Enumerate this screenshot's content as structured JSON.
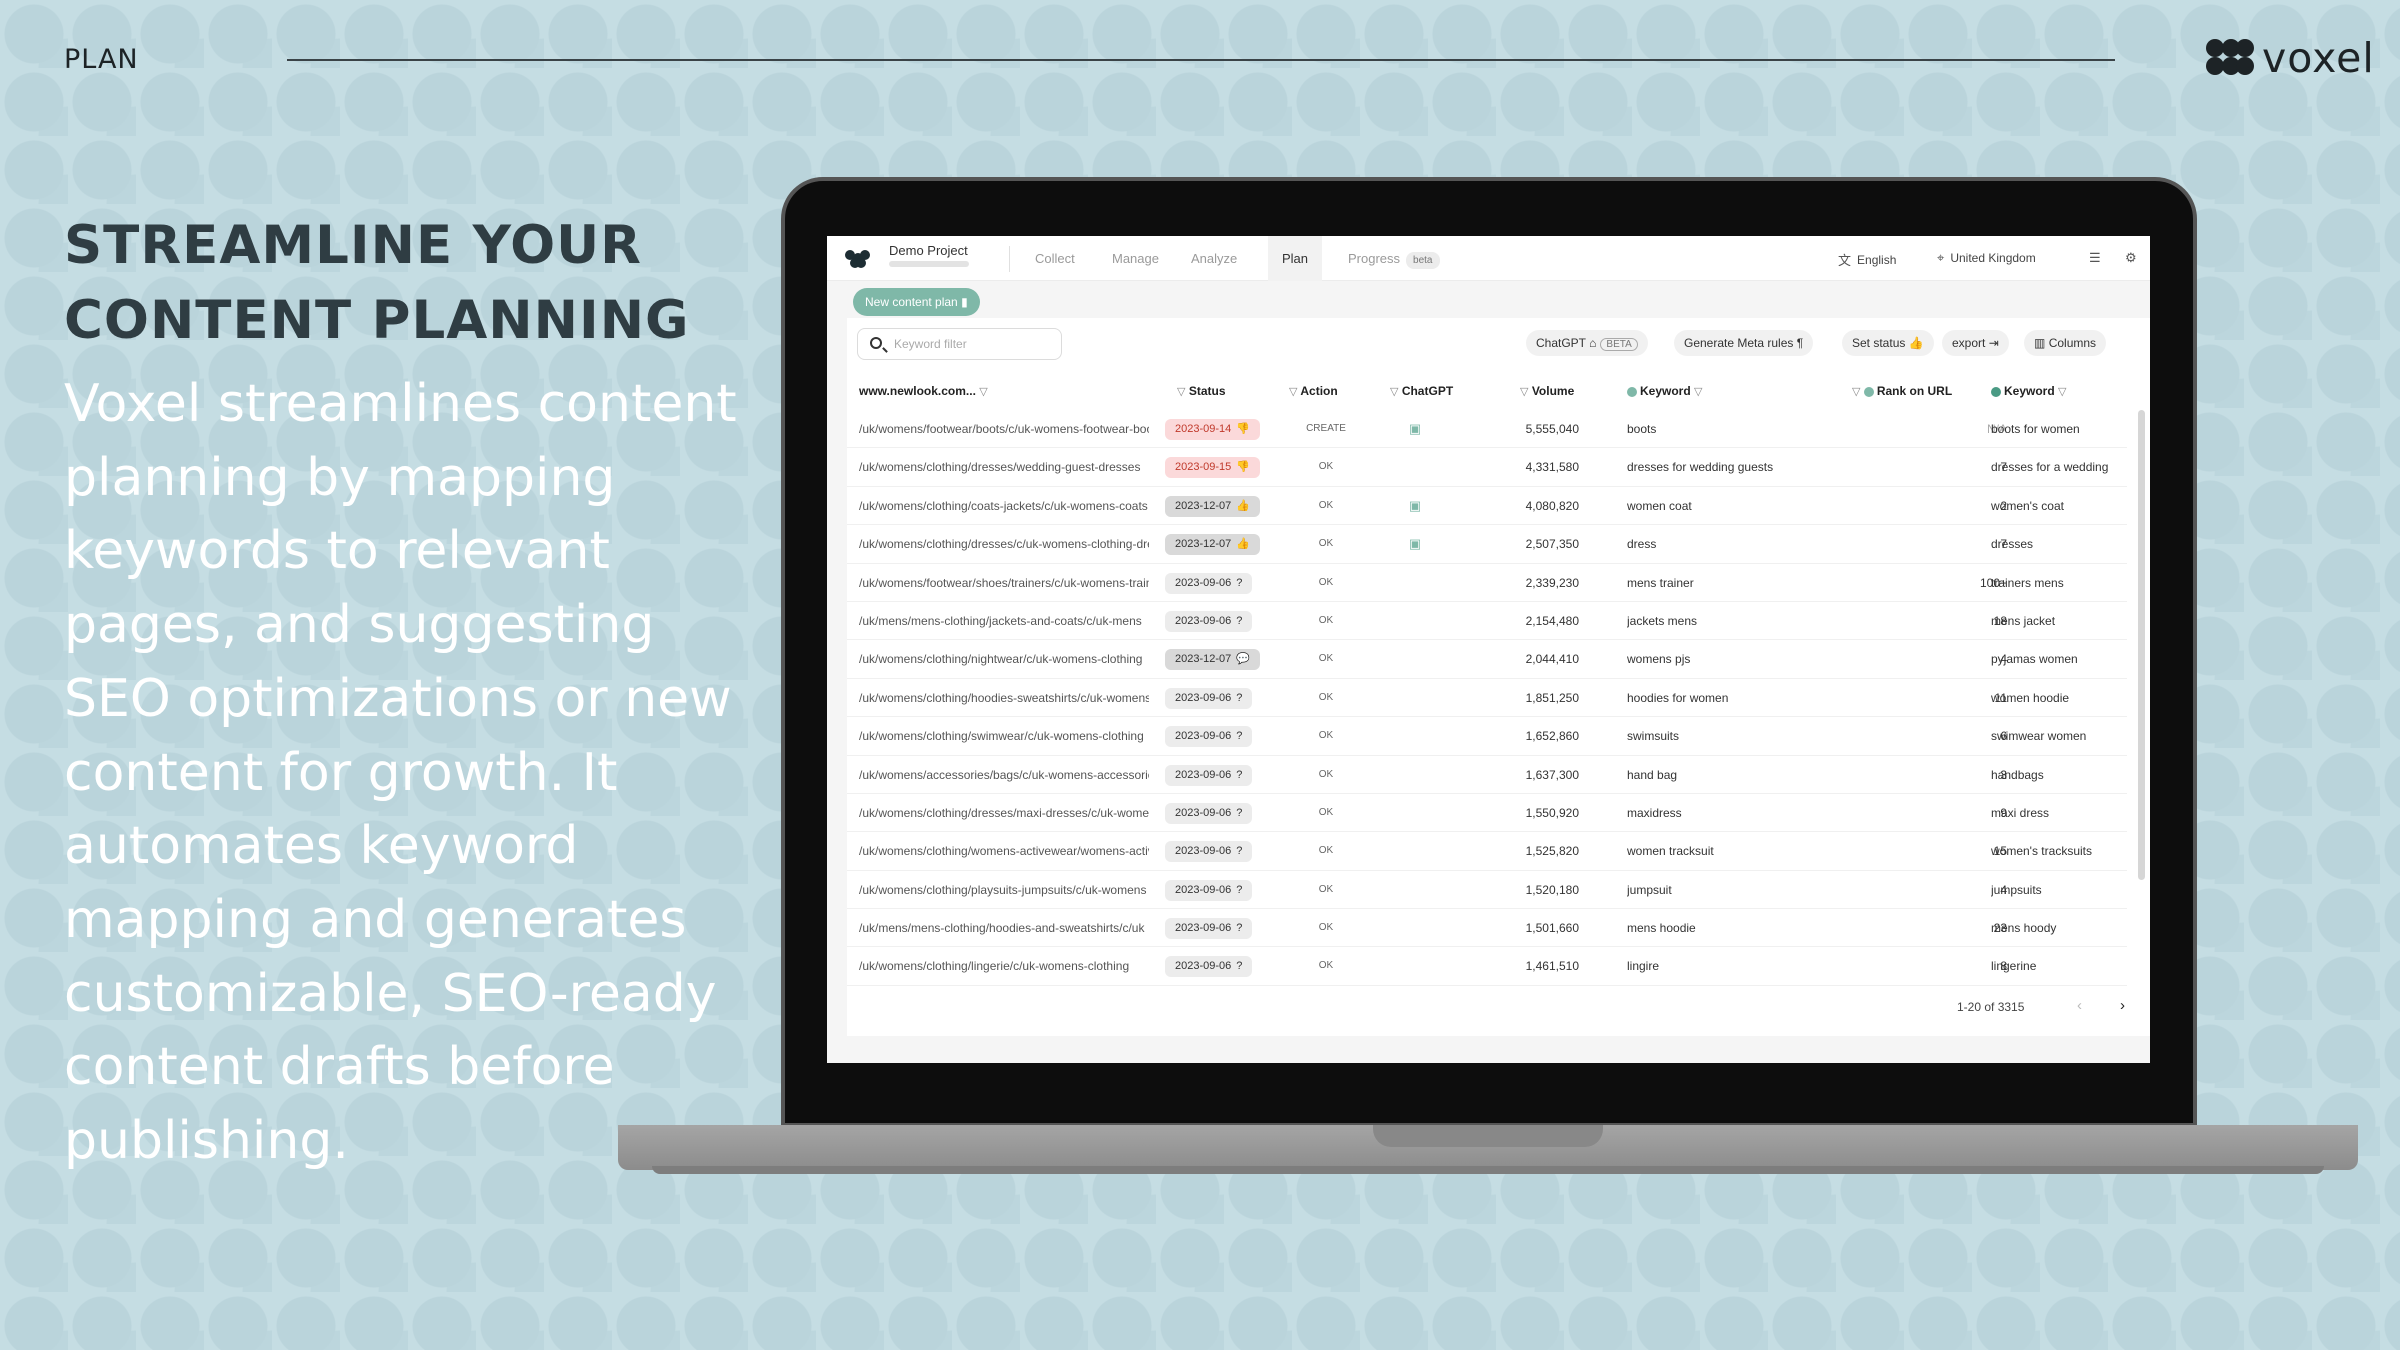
{
  "header": {
    "section_label": "PLAN",
    "brand_name": "voxel"
  },
  "hero": {
    "headline": "STREAMLINE YOUR CONTENT PLANNING",
    "body": "Voxel streamlines content planning by mapping keywords to relevant pages, and suggesting SEO optimizations or new content for growth. It automates keyword mapping and generates customizable, SEO-ready content drafts before publishing."
  },
  "app": {
    "project_name": "Demo Project",
    "nav_tabs": [
      "Collect",
      "Manage",
      "Analyze",
      "Plan",
      "Progress"
    ],
    "active_tab": "Plan",
    "progress_badge": "beta",
    "language": "English",
    "country": "United Kingdom",
    "new_plan_label": "New content plan",
    "keyword_filter_placeholder": "Keyword filter",
    "toolbar": {
      "chatgpt": "ChatGPT",
      "chatgpt_badge": "BETA",
      "meta_rules": "Generate Meta rules",
      "set_status": "Set status",
      "export": "export",
      "columns": "Columns"
    },
    "columns": {
      "url": "www.newlook.com...",
      "status": "Status",
      "action": "Action",
      "chatgpt": "ChatGPT",
      "volume": "Volume",
      "keyword": "Keyword",
      "rank": "Rank on URL",
      "keyword2": "Keyword"
    },
    "rows": [
      {
        "url": "/uk/womens/footwear/boots/c/uk-womens-footwear-boots",
        "status": "2023-09-14",
        "status_style": "red",
        "status_icon": "thumbs-down-icon",
        "action": "CREATE",
        "chatgpt": true,
        "volume": "5,555,040",
        "keyword": "boots",
        "rank": "N/A",
        "keyword2": "boots for women"
      },
      {
        "url": "/uk/womens/clothing/dresses/wedding-guest-dresses",
        "status": "2023-09-15",
        "status_style": "red",
        "status_icon": "thumbs-down-icon",
        "action": "OK",
        "chatgpt": false,
        "volume": "4,331,580",
        "keyword": "dresses for wedding guests",
        "rank": "7",
        "keyword2": "dresses for a wedding"
      },
      {
        "url": "/uk/womens/clothing/coats-jackets/c/uk-womens-coats",
        "status": "2023-12-07",
        "status_style": "dark",
        "status_icon": "thumbs-up-icon",
        "action": "OK",
        "chatgpt": true,
        "volume": "4,080,820",
        "keyword": "women coat",
        "rank": "2",
        "keyword2": "women's coat"
      },
      {
        "url": "/uk/womens/clothing/dresses/c/uk-womens-clothing-dresses",
        "status": "2023-12-07",
        "status_style": "dark",
        "status_icon": "thumbs-up-icon",
        "action": "OK",
        "chatgpt": true,
        "volume": "2,507,350",
        "keyword": "dress",
        "rank": "7",
        "keyword2": "dresses"
      },
      {
        "url": "/uk/womens/footwear/shoes/trainers/c/uk-womens-trainers",
        "status": "2023-09-06",
        "status_style": "plain",
        "status_icon": "question-icon",
        "action": "OK",
        "chatgpt": false,
        "volume": "2,339,230",
        "keyword": "mens trainer",
        "rank": "100+",
        "keyword2": "trainers mens"
      },
      {
        "url": "/uk/mens/mens-clothing/jackets-and-coats/c/uk-mens",
        "status": "2023-09-06",
        "status_style": "plain",
        "status_icon": "question-icon",
        "action": "OK",
        "chatgpt": false,
        "volume": "2,154,480",
        "keyword": "jackets mens",
        "rank": "18",
        "keyword2": "mens jacket"
      },
      {
        "url": "/uk/womens/clothing/nightwear/c/uk-womens-clothing",
        "status": "2023-12-07",
        "status_style": "dark",
        "status_icon": "comment-icon",
        "action": "OK",
        "chatgpt": false,
        "volume": "2,044,410",
        "keyword": "womens pjs",
        "rank": "4",
        "keyword2": "pyjamas women"
      },
      {
        "url": "/uk/womens/clothing/hoodies-sweatshirts/c/uk-womens",
        "status": "2023-09-06",
        "status_style": "plain",
        "status_icon": "question-icon",
        "action": "OK",
        "chatgpt": false,
        "volume": "1,851,250",
        "keyword": "hoodies for women",
        "rank": "11",
        "keyword2": "women hoodie"
      },
      {
        "url": "/uk/womens/clothing/swimwear/c/uk-womens-clothing",
        "status": "2023-09-06",
        "status_style": "plain",
        "status_icon": "question-icon",
        "action": "OK",
        "chatgpt": false,
        "volume": "1,652,860",
        "keyword": "swimsuits",
        "rank": "6",
        "keyword2": "swimwear women"
      },
      {
        "url": "/uk/womens/accessories/bags/c/uk-womens-accessories",
        "status": "2023-09-06",
        "status_style": "plain",
        "status_icon": "question-icon",
        "action": "OK",
        "chatgpt": false,
        "volume": "1,637,300",
        "keyword": "hand bag",
        "rank": "3",
        "keyword2": "handbags"
      },
      {
        "url": "/uk/womens/clothing/dresses/maxi-dresses/c/uk-womens",
        "status": "2023-09-06",
        "status_style": "plain",
        "status_icon": "question-icon",
        "action": "OK",
        "chatgpt": false,
        "volume": "1,550,920",
        "keyword": "maxidress",
        "rank": "9",
        "keyword2": "maxi dress"
      },
      {
        "url": "/uk/womens/clothing/womens-activewear/womens-activewear",
        "status": "2023-09-06",
        "status_style": "plain",
        "status_icon": "question-icon",
        "action": "OK",
        "chatgpt": false,
        "volume": "1,525,820",
        "keyword": "women tracksuit",
        "rank": "15",
        "keyword2": "women's tracksuits"
      },
      {
        "url": "/uk/womens/clothing/playsuits-jumpsuits/c/uk-womens",
        "status": "2023-09-06",
        "status_style": "plain",
        "status_icon": "question-icon",
        "action": "OK",
        "chatgpt": false,
        "volume": "1,520,180",
        "keyword": "jumpsuit",
        "rank": "4",
        "keyword2": "jumpsuits"
      },
      {
        "url": "/uk/mens/mens-clothing/hoodies-and-sweatshirts/c/uk",
        "status": "2023-09-06",
        "status_style": "plain",
        "status_icon": "question-icon",
        "action": "OK",
        "chatgpt": false,
        "volume": "1,501,660",
        "keyword": "mens hoodie",
        "rank": "23",
        "keyword2": "mens hoody"
      },
      {
        "url": "/uk/womens/clothing/lingerie/c/uk-womens-clothing",
        "status": "2023-09-06",
        "status_style": "plain",
        "status_icon": "question-icon",
        "action": "OK",
        "chatgpt": false,
        "volume": "1,461,510",
        "keyword": "lingire",
        "rank": "8",
        "keyword2": "lingerine"
      }
    ],
    "pagination": "1-20 of 3315"
  }
}
